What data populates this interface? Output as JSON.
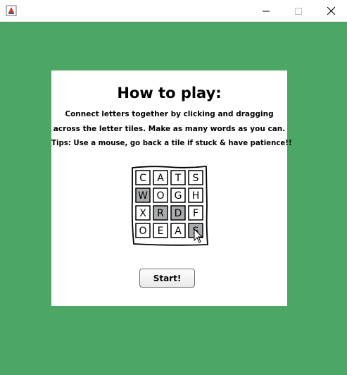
{
  "window": {
    "title": "",
    "controls": [
      "minimize",
      "maximize",
      "close"
    ]
  },
  "instructions": {
    "title": "How to play:",
    "line1": "Connect letters together by clicking and dragging",
    "line2": "across the letter tiles. Make as many words as you can.",
    "tips": "Tips: Use a mouse, go back a tile if stuck & have patience!!"
  },
  "illustration": {
    "grid": [
      [
        {
          "letter": "C",
          "selected": false
        },
        {
          "letter": "A",
          "selected": false
        },
        {
          "letter": "T",
          "selected": false
        },
        {
          "letter": "S",
          "selected": false
        }
      ],
      [
        {
          "letter": "W",
          "selected": true
        },
        {
          "letter": "O",
          "selected": false
        },
        {
          "letter": "G",
          "selected": false
        },
        {
          "letter": "H",
          "selected": false
        }
      ],
      [
        {
          "letter": "X",
          "selected": false
        },
        {
          "letter": "R",
          "selected": true
        },
        {
          "letter": "D",
          "selected": true
        },
        {
          "letter": "F",
          "selected": false
        }
      ],
      [
        {
          "letter": "O",
          "selected": false
        },
        {
          "letter": "E",
          "selected": false
        },
        {
          "letter": "A",
          "selected": false
        },
        {
          "letter": "S",
          "selected": true
        }
      ]
    ],
    "selected_color": "#a9acae",
    "cursor_icon": "arrow-cursor-icon"
  },
  "start_button": {
    "label": "Start!"
  },
  "colors": {
    "background": "#4ca664",
    "card": "#ffffff"
  }
}
